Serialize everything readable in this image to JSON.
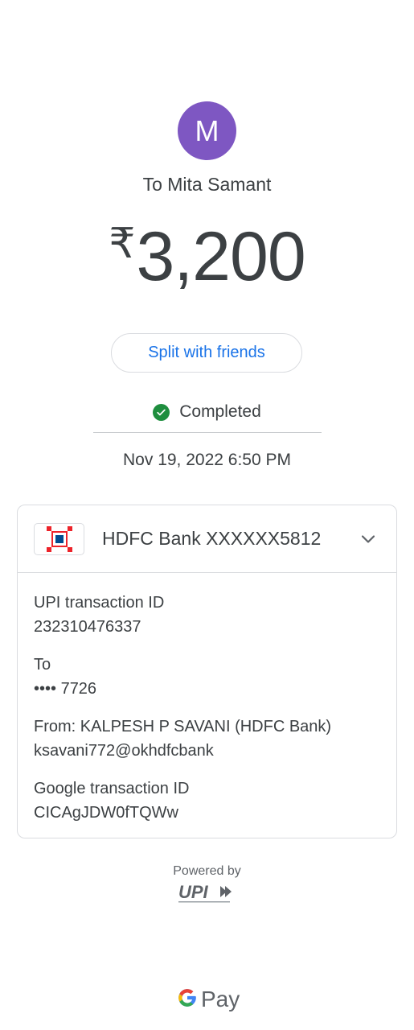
{
  "recipient": {
    "avatar_letter": "M",
    "label": "To Mita Samant"
  },
  "payment": {
    "currency_symbol": "₹",
    "amount": "3,200",
    "split_label": "Split with friends",
    "status": "Completed",
    "datetime": "Nov 19, 2022 6:50 PM"
  },
  "details": {
    "bank_account": "HDFC Bank XXXXXX5812",
    "fields": [
      {
        "label": "UPI transaction ID",
        "value": "232310476337"
      },
      {
        "label": "To",
        "value": "•••• 7726"
      },
      {
        "label": "From: KALPESH P SAVANI (HDFC Bank)",
        "value": "ksavani772@okhdfcbank"
      },
      {
        "label": "Google transaction ID",
        "value": "CICAgJDW0fTQWw"
      }
    ]
  },
  "footer": {
    "powered_by": "Powered by",
    "upi_text": "UPI",
    "brand_pay": "Pay"
  },
  "colors": {
    "avatar": "#7e57c2",
    "accent": "#1a73e8",
    "success": "#1e8e3e",
    "hdfc_red": "#ed232a",
    "hdfc_blue": "#004c8f"
  },
  "icons": [
    "check-circle-icon",
    "hdfc-logo-icon",
    "chevron-down-icon",
    "upi-logo",
    "google-g-icon"
  ]
}
